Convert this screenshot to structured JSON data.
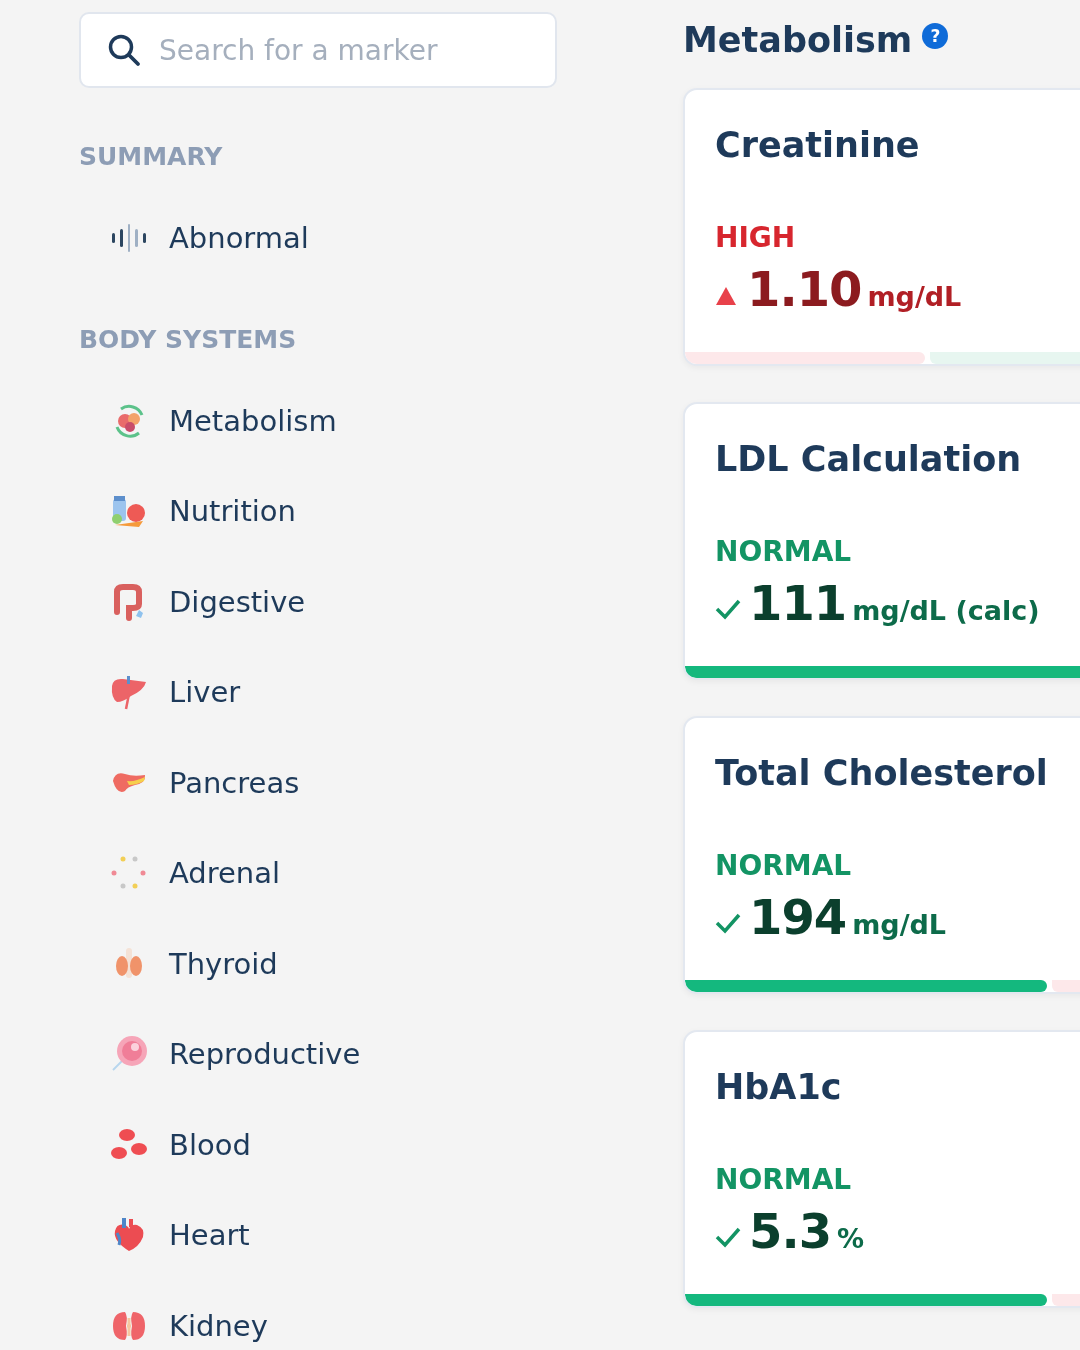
{
  "sidebar": {
    "search": {
      "placeholder": "Search for a marker"
    },
    "sections": [
      {
        "heading": "SUMMARY",
        "items": [
          {
            "label": "Abnormal",
            "selected": false
          }
        ]
      },
      {
        "heading": "BODY SYSTEMS",
        "items": [
          {
            "label": "Metabolism",
            "selected": false
          },
          {
            "label": "Nutrition",
            "selected": false
          },
          {
            "label": "Digestive",
            "selected": false
          },
          {
            "label": "Liver",
            "selected": false
          },
          {
            "label": "Pancreas",
            "selected": false
          },
          {
            "label": "Adrenal",
            "selected": false
          },
          {
            "label": "Thyroid",
            "selected": false
          },
          {
            "label": "Reproductive",
            "selected": false
          },
          {
            "label": "Blood",
            "selected": false
          },
          {
            "label": "Heart",
            "selected": false
          },
          {
            "label": "Kidney",
            "selected": false
          }
        ]
      }
    ]
  },
  "main": {
    "title": "Metabolism",
    "help_icon": "?",
    "markers": [
      {
        "name": "Creatinine",
        "status": "HIGH",
        "kind": "high",
        "value": "1.10",
        "unit": "mg/dL",
        "range": [
          {
            "kind": "low",
            "active": false
          },
          {
            "kind": "normal",
            "active": false
          }
        ]
      },
      {
        "name": "LDL Calculation",
        "status": "NORMAL",
        "kind": "normal",
        "value": "111",
        "unit": "mg/dL (calc)",
        "range": [
          {
            "kind": "normal",
            "active": true
          }
        ]
      },
      {
        "name": "Total Cholesterol",
        "status": "NORMAL",
        "kind": "normal",
        "value": "194",
        "unit": "mg/dL",
        "range": [
          {
            "kind": "normal",
            "active": true
          },
          {
            "kind": "high",
            "active": false
          }
        ]
      },
      {
        "name": "HbA1c",
        "status": "NORMAL",
        "kind": "normal",
        "value": "5.3",
        "unit": "%",
        "range": [
          {
            "kind": "normal",
            "active": true
          },
          {
            "kind": "high",
            "active": false
          }
        ]
      }
    ]
  }
}
